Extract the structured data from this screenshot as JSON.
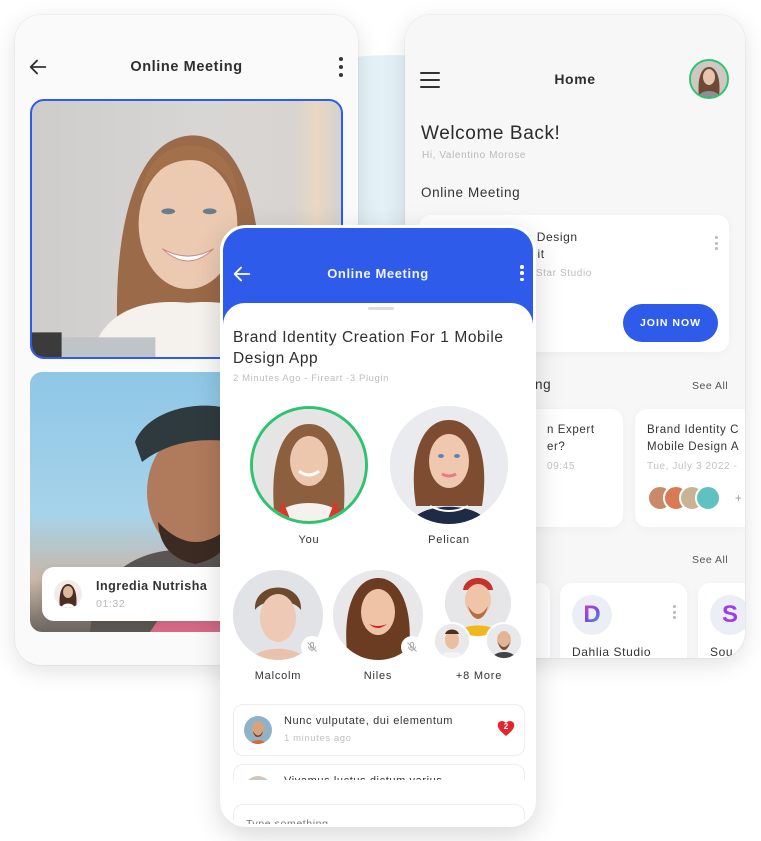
{
  "colors": {
    "accent": "#2e5bea",
    "online": "#2ec46f",
    "like": "#e8232b",
    "bg_circle": "#e4f2f8"
  },
  "left_screen": {
    "title": "Online Meeting",
    "back_icon": "arrow-left-icon",
    "menu_icon": "kebab-menu-icon",
    "caller": {
      "name": "Ingredia Nutrisha",
      "duration": "01:32"
    }
  },
  "home_screen": {
    "title": "Home",
    "menu_icon": "hamburger-icon",
    "welcome": "Welcome Back!",
    "greeting": "Hi, Valentino Morose",
    "online_meeting": {
      "section_title": "Online Meeting",
      "card": {
        "line1": "ile Design",
        "line2": "ne it",
        "meta": "art Star Studio",
        "join_label": "JOIN NOW"
      }
    },
    "upcoming": {
      "section_title_partial": "ng",
      "see_all": "See All",
      "cards": [
        {
          "line1": "n Expert",
          "line2": "er?",
          "date": "09:45"
        },
        {
          "line1": "Brand Identity C",
          "line2": "Mobile Design A",
          "date": "Tue, July 3 2022 -",
          "more": "+"
        }
      ]
    },
    "studios": {
      "see_all": "See All",
      "items": [
        {
          "name": "Dahlia Studio",
          "logo": "D"
        },
        {
          "name": "Sou",
          "logo": "S"
        }
      ]
    }
  },
  "center_screen": {
    "title": "Online Meeting",
    "meeting_title": "Brand Identity Creation For 1 Mobile Design App",
    "meeting_meta": "2 Minutes Ago - Fireart -3 Plugin",
    "participants": [
      {
        "name": "You",
        "speaking": true,
        "muted": false
      },
      {
        "name": "Pelican",
        "speaking": false,
        "muted": false
      },
      {
        "name": "Malcolm",
        "speaking": false,
        "muted": true
      },
      {
        "name": "Niles",
        "speaking": false,
        "muted": true
      },
      {
        "name": "+8 More",
        "speaking": false,
        "muted": false
      }
    ],
    "comments": [
      {
        "text": "Nunc vulputate, dui elementum",
        "time": "1 minutes ago",
        "likes": "2"
      },
      {
        "text": "Vivamus luctus dictum varius",
        "time": "",
        "likes": ""
      }
    ],
    "input_placeholder": "Type something"
  }
}
